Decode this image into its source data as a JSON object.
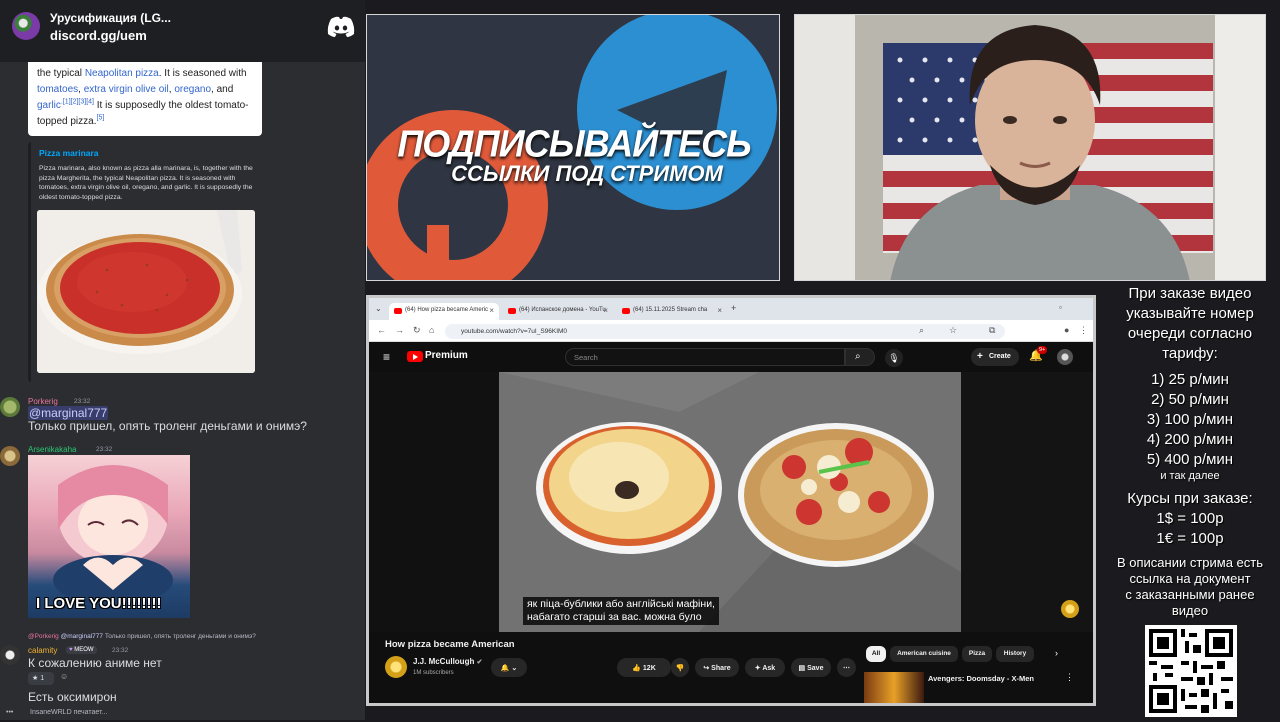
{
  "discord": {
    "server_name": "Урусификация (LG...",
    "server_link": "discord.gg/uem",
    "wiki_excerpt": {
      "line1_pre": "the typical ",
      "line1_link": "Neapolitan pizza",
      "line1_post": ". It is seasoned with",
      "line2_link1": "tomatoes",
      "line2_sep1": ", ",
      "line2_link2": "extra virgin olive oil",
      "line2_sep2": ", ",
      "line2_link3": "oregano",
      "line2_post": ", and",
      "line3_link": "garlic",
      "line3_refs": ".[1][2][3][4]",
      "line3_post": " It is supposedly the oldest tomato-",
      "line4": "topped pizza.",
      "line4_ref": "[5]"
    },
    "embed": {
      "title": "Pizza marinara",
      "description": "Pizza marinara, also known as pizza alla marinara, is, together with the pizza Margherita, the typical Neapolitan pizza. It is seasoned with tomatoes, extra virgin olive oil, oregano, and garlic. It is supposedly the oldest tomato-topped pizza."
    },
    "messages": [
      {
        "user": "Porkerig",
        "time": "23:32",
        "mention": "@marginal777",
        "text": "Только пришел, опять троленг деньгами и онимэ?"
      },
      {
        "user": "Arsenikakaha",
        "time": "23:32",
        "image_caption": "I LOVE YOU!!!!!!!!"
      },
      {
        "reply_user": "@Porkerig",
        "reply_mention": "@marginal777",
        "reply_text": "Только пришел, опять троленг деньгами и онимэ?",
        "user": "calamity",
        "tag": "MEOW",
        "time": "23:32",
        "text": "К сожалению аниме нет",
        "reaction_count": "1"
      },
      {
        "text": "Есть оксимирон"
      }
    ],
    "typing": "InsaneWRLD печатает..."
  },
  "promo": {
    "title": "ПОДПИСЫВАЙТЕСЬ",
    "subtitle": "ССЫЛКИ ПОД СТРИМОМ"
  },
  "browser": {
    "tabs": [
      {
        "label": "(64) How pizza became Americ"
      },
      {
        "label": "(64) Испанское домена - YouTu"
      },
      {
        "label": "(64) 15.11.2025 Stream cha"
      }
    ],
    "url": "youtube.com/watch?v=7uI_S96KIM0"
  },
  "youtube": {
    "logo_label": "Premium",
    "search_placeholder": "Search",
    "create_label": "Create",
    "notif_count": "9+",
    "caption_line1": "як піца-бублики або англійські мафіни,",
    "caption_line2": "набагато старші за вас.  можна було",
    "video_title": "How pizza became American",
    "channel_name": "J.J. McCullough",
    "subscribers": "1M subscribers",
    "likes": "12K",
    "share_label": "Share",
    "ask_label": "Ask",
    "save_label": "Save",
    "chips": [
      "All",
      "American cuisine",
      "Pizza",
      "History"
    ],
    "rec_title": "Avengers: Doomsday - X-Men"
  },
  "info": {
    "intro": [
      "При заказе видео",
      "указывайте номер",
      "очереди согласно",
      "тарифу:"
    ],
    "tariffs": [
      "1) 25 р/мин",
      "2) 50 р/мин",
      "3) 100 р/мин",
      "4) 200 р/мин",
      "5) 400 р/мин"
    ],
    "etc": "и так далее",
    "rates_title": "Курсы при заказе:",
    "rates": [
      "1$ = 100р",
      "1€ = 100р"
    ],
    "desc": [
      "В описании стрима есть",
      "ссылка на документ",
      "с заказанными ранее",
      "видео"
    ]
  }
}
